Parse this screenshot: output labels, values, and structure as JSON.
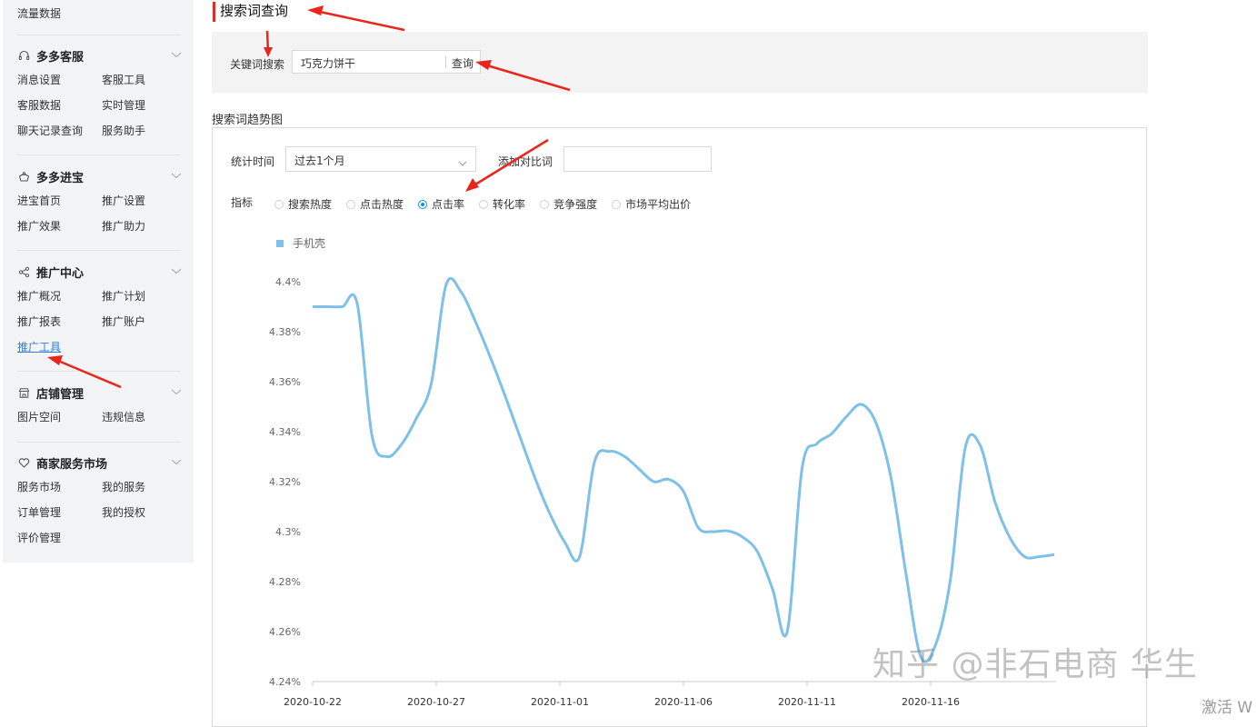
{
  "sidebar": {
    "top_item": "流量数据",
    "sections": [
      {
        "title": "多多客服",
        "icon": "headset-icon",
        "items": [
          "消息设置",
          "客服工具",
          "客服数据",
          "实时管理",
          "聊天记录查询",
          "服务助手"
        ]
      },
      {
        "title": "多多进宝",
        "icon": "treasure-icon",
        "items": [
          "进宝首页",
          "推广设置",
          "推广效果",
          "推广助力"
        ]
      },
      {
        "title": "推广中心",
        "icon": "share-icon",
        "items": [
          "推广概况",
          "推广计划",
          "推广报表",
          "推广账户",
          "推广工具"
        ],
        "active": "推广工具"
      },
      {
        "title": "店铺管理",
        "icon": "store-icon",
        "items": [
          "图片空间",
          "违规信息"
        ]
      },
      {
        "title": "商家服务市场",
        "icon": "heart-icon",
        "items": [
          "服务市场",
          "我的服务",
          "订单管理",
          "我的授权",
          "评价管理"
        ]
      }
    ]
  },
  "main": {
    "title": "搜索词查询",
    "search": {
      "label": "关键词搜索",
      "value": "巧克力饼干",
      "button": "查询"
    },
    "trend_title": "搜索词趋势图",
    "period_label": "统计时间",
    "period_value": "过去1个月",
    "compare_label": "添加对比词",
    "compare_value": "",
    "metric_label": "指标",
    "metrics": [
      "搜索热度",
      "点击热度",
      "点击率",
      "转化率",
      "竞争强度",
      "市场平均出价"
    ],
    "selected_metric": "点击率"
  },
  "chart_data": {
    "type": "line",
    "series": [
      {
        "name": "手机壳",
        "color": "#7ec0e8",
        "values": [
          4.39,
          4.39,
          4.39,
          4.3913,
          4.3384,
          4.33,
          4.335,
          4.3454,
          4.3594,
          4.3988,
          4.396,
          4.3837,
          4.3695,
          4.3539,
          4.3376,
          4.3213,
          4.3071,
          4.2958,
          4.29,
          4.3279,
          4.3321,
          4.3302,
          4.3251,
          4.32,
          4.3209,
          4.3161,
          4.3016,
          4.3,
          4.3003,
          4.2978,
          4.2918,
          4.2772,
          4.26,
          4.3255,
          4.3352,
          4.3392,
          4.3461,
          4.3509,
          4.3432,
          4.3213,
          4.2833,
          4.25,
          4.2547,
          4.2809,
          4.3336,
          4.3346,
          4.312,
          4.2977,
          4.29,
          4.29,
          4.2908
        ]
      }
    ],
    "x_start": "2020-10-22",
    "x_step_days": 0.6,
    "x_tick_labels": [
      "2020-10-22",
      "2020-10-27",
      "2020-11-01",
      "2020-11-06",
      "2020-11-11",
      "2020-11-16"
    ],
    "y_tick_labels": [
      "4.24%",
      "4.26%",
      "4.28%",
      "4.3%",
      "4.32%",
      "4.34%",
      "4.36%",
      "4.38%",
      "4.4%"
    ],
    "ylim": [
      4.24,
      4.4
    ],
    "ylabel_unit": "%"
  },
  "overlay": {
    "watermark": "知乎 @非石电商 华生",
    "activate_text": "激活 W"
  }
}
